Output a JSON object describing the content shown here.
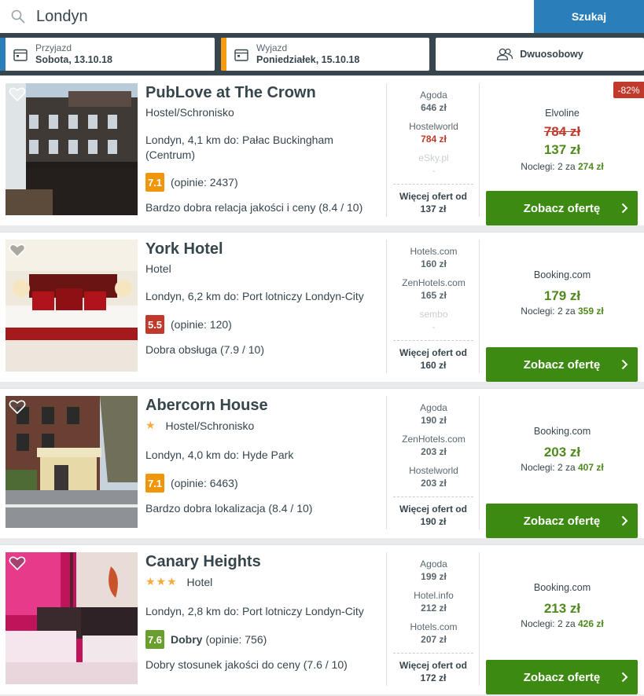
{
  "search": {
    "value": "Londyn",
    "button": "Szukaj"
  },
  "filters": {
    "checkin": {
      "label": "Przyjazd",
      "value": "Sobota, 13.10.18",
      "accent": "#2a7fba"
    },
    "checkout": {
      "label": "Wyjazd",
      "value": "Poniedziałek, 15.10.18",
      "accent": "#f39c12"
    },
    "guests": {
      "value": "Dwuosobowy"
    }
  },
  "colors": {
    "rating_orange": "#f0960a",
    "rating_red": "#c0392b",
    "rating_green": "#6a9e2f",
    "cta_green": "#3c8a12",
    "price_green": "#4e8a1c"
  },
  "hotels": [
    {
      "name": "PubLove at The Crown",
      "type": "Hostel/Schronisko",
      "stars": "",
      "location": "Londyn, 4,1 km do: Pałac Buckingham (Centrum)",
      "rating": "7.1",
      "rating_word": "",
      "reviews": "(opinie: 2437)",
      "review_text": "Bardzo dobra relacja jakości i ceny (8.4 / 10)",
      "deals": [
        {
          "site": "Agoda",
          "price": "646 zł"
        },
        {
          "site": "Hostelworld",
          "price": "784 zł"
        },
        {
          "site": "eSky.pl",
          "price": "-"
        }
      ],
      "more_label": "Więcej ofert od",
      "more_price": "137 zł",
      "discount": "-82%",
      "best_site": "Elvoline",
      "old_price": "784 zł",
      "best_price": "137 zł",
      "nights_label": "Noclegi: 2 za",
      "nights_total": "274 zł",
      "cta": "Zobacz ofertę"
    },
    {
      "name": "York Hotel",
      "type": "Hotel",
      "stars": "",
      "location": "Londyn, 6,2 km do: Port lotniczy Londyn-City",
      "rating": "5.5",
      "rating_word": "",
      "reviews": "(opinie: 120)",
      "review_text": "Dobra obsługa (7.9 / 10)",
      "deals": [
        {
          "site": "Hotels.com",
          "price": "160 zł"
        },
        {
          "site": "ZenHotels.com",
          "price": "165 zł"
        },
        {
          "site": "sembo",
          "price": "-"
        }
      ],
      "more_label": "Więcej ofert od",
      "more_price": "160 zł",
      "discount": "",
      "best_site": "Booking.com",
      "old_price": "",
      "best_price": "179 zł",
      "nights_label": "Noclegi: 2 za",
      "nights_total": "359 zł",
      "cta": "Zobacz ofertę"
    },
    {
      "name": "Abercorn House",
      "type": "Hostel/Schronisko",
      "stars": "★",
      "location": "Londyn, 4,0 km do: Hyde Park",
      "rating": "7.1",
      "rating_word": "",
      "reviews": "(opinie: 6463)",
      "review_text": "Bardzo dobra lokalizacja (8.4 / 10)",
      "deals": [
        {
          "site": "Agoda",
          "price": "190 zł"
        },
        {
          "site": "ZenHotels.com",
          "price": "203 zł"
        },
        {
          "site": "Hostelworld",
          "price": "203 zł"
        }
      ],
      "more_label": "Więcej ofert od",
      "more_price": "190 zł",
      "discount": "",
      "best_site": "Booking.com",
      "old_price": "",
      "best_price": "203 zł",
      "nights_label": "Noclegi: 2 za",
      "nights_total": "407 zł",
      "cta": "Zobacz ofertę"
    },
    {
      "name": "Canary Heights",
      "type": "Hotel",
      "stars": "★★★",
      "location": "Londyn, 2,8 km do: Port lotniczy Londyn-City",
      "rating": "7.6",
      "rating_word": "Dobry",
      "reviews": "(opinie: 756)",
      "review_text": "Dobry stosunek jakości do ceny (7.6 / 10)",
      "deals": [
        {
          "site": "Agoda",
          "price": "199 zł"
        },
        {
          "site": "Hotel.info",
          "price": "212 zł"
        },
        {
          "site": "Hotels.com",
          "price": "207 zł"
        }
      ],
      "more_label": "Więcej ofert od",
      "more_price": "172 zł",
      "discount": "",
      "best_site": "Booking.com",
      "old_price": "",
      "best_price": "213 zł",
      "nights_label": "Noclegi: 2 za",
      "nights_total": "426 zł",
      "cta": "Zobacz ofertę"
    }
  ]
}
